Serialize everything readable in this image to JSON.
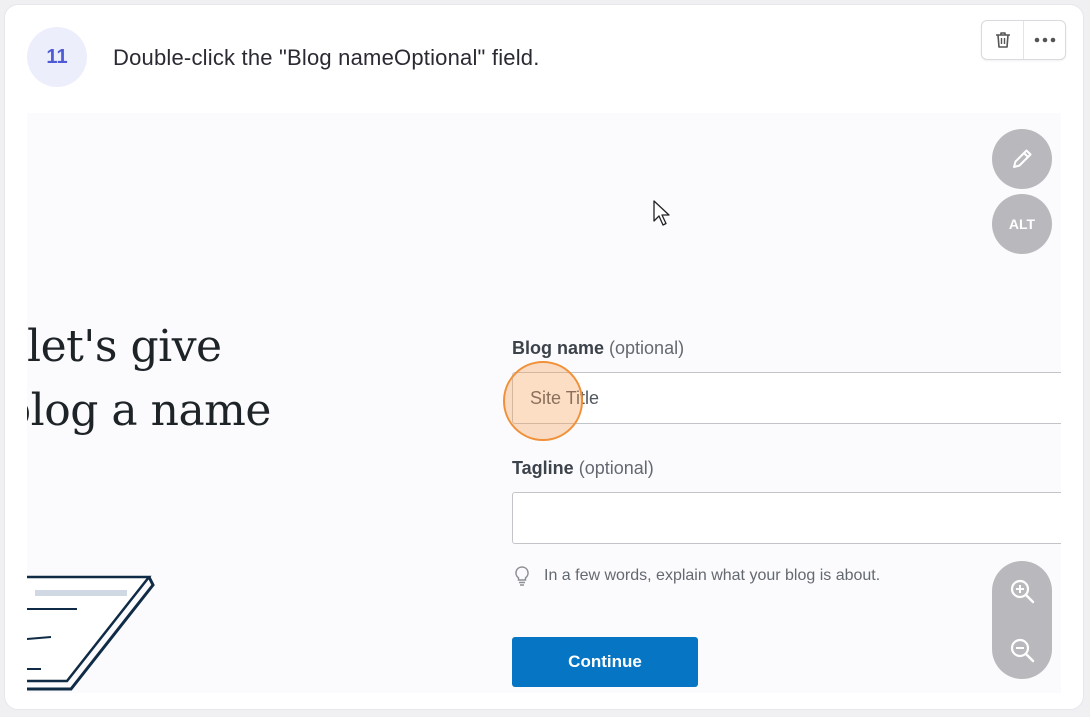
{
  "step": {
    "number": "11",
    "instruction": "Double-click the \"Blog nameOptional\" field."
  },
  "toolbar": {
    "delete_icon": "trash-icon",
    "more_icon": "more-dots-icon"
  },
  "screenshot": {
    "headline_line1": "let's give",
    "headline_line2": "blog a name",
    "blog_name_label": "Blog name",
    "blog_name_optional": "(optional)",
    "blog_name_value": "Site Title",
    "tagline_label": "Tagline",
    "tagline_optional": "(optional)",
    "tagline_value": "",
    "hint_text": "In a few words, explain what your blog is about.",
    "continue_label": "Continue",
    "alt_label": "ALT"
  },
  "colors": {
    "accent": "#4f5bd5",
    "continue_button": "#0675c4",
    "click_marker": "#f0913a",
    "overlay_buttons": "#b9b9bd"
  }
}
